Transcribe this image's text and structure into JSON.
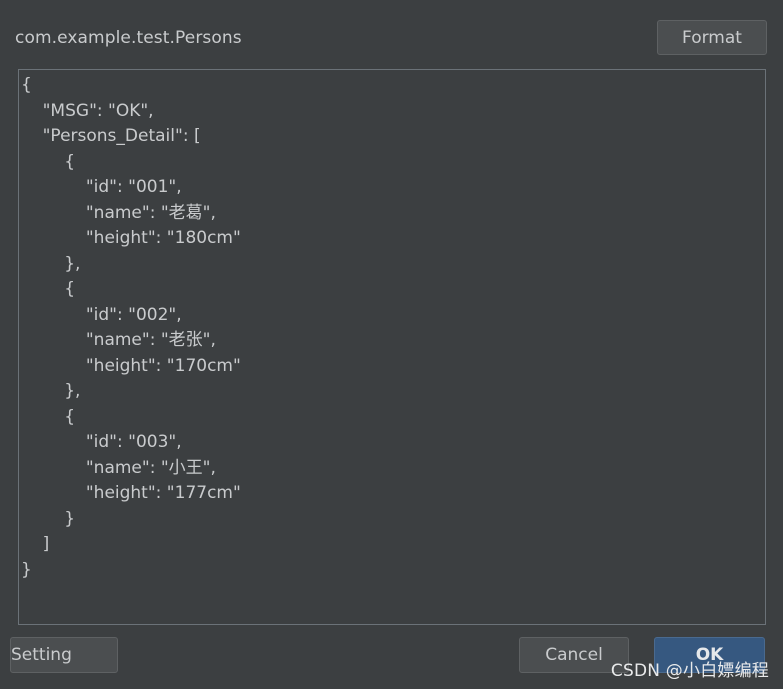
{
  "dialog": {
    "class_name": "com.example.test.Persons",
    "format_label": "Format",
    "setting_label": "Setting",
    "cancel_label": "Cancel",
    "ok_label": "OK"
  },
  "editor": {
    "lines": [
      "{",
      "    \"MSG\": \"OK\",",
      "    \"Persons_Detail\": [",
      "        {",
      "            \"id\": \"001\",",
      "            \"name\": \"老葛\",",
      "            \"height\": \"180cm\"",
      "        },",
      "        {",
      "            \"id\": \"002\",",
      "            \"name\": \"老张\",",
      "            \"height\": \"170cm\"",
      "        },",
      "        {",
      "            \"id\": \"003\",",
      "            \"name\": \"小王\",",
      "            \"height\": \"177cm\"",
      "        }",
      "    ]",
      "}"
    ]
  },
  "watermark": "CSDN @小白嫖编程",
  "colors": {
    "background": "#3c3f41",
    "text": "#c9cbcd",
    "ok_button": "#365880"
  }
}
